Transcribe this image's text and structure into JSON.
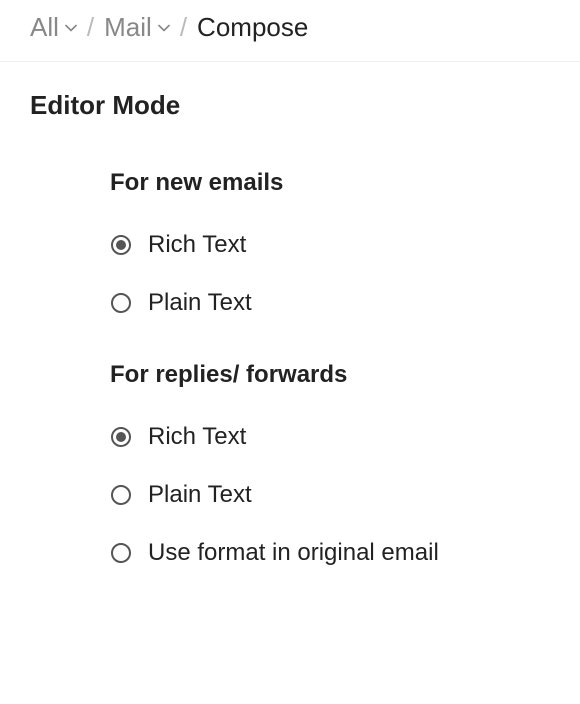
{
  "breadcrumb": {
    "items": [
      {
        "label": "All",
        "hasDropdown": true
      },
      {
        "label": "Mail",
        "hasDropdown": true
      },
      {
        "label": "Compose",
        "hasDropdown": false
      }
    ]
  },
  "section": {
    "title": "Editor Mode",
    "groups": [
      {
        "title": "For new emails",
        "options": [
          {
            "label": "Rich Text",
            "selected": true
          },
          {
            "label": "Plain Text",
            "selected": false
          }
        ]
      },
      {
        "title": "For replies/ forwards",
        "options": [
          {
            "label": "Rich Text",
            "selected": true
          },
          {
            "label": "Plain Text",
            "selected": false
          },
          {
            "label": "Use format in original email",
            "selected": false
          }
        ]
      }
    ]
  }
}
